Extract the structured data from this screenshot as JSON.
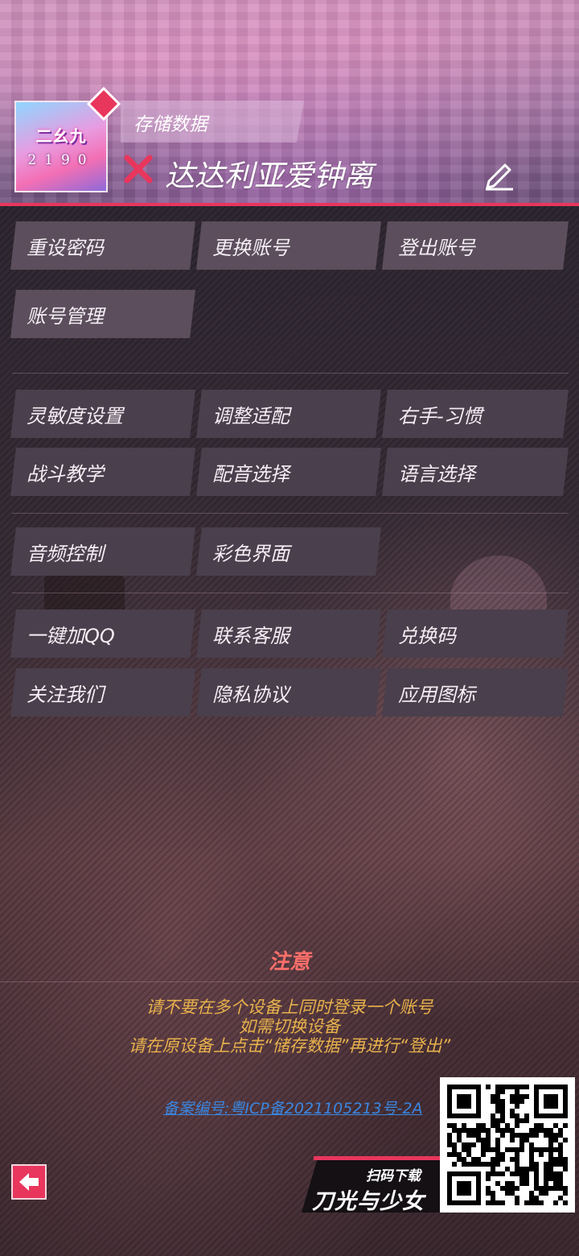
{
  "header": {
    "avatar_title": "二幺九",
    "avatar_number": "2190",
    "save_tab_label": "存储数据",
    "player_name": "达达利亚爱钟离"
  },
  "account": {
    "reset_password": "重设密码",
    "switch_account": "更换账号",
    "logout": "登出账号",
    "manage": "账号管理"
  },
  "settings": {
    "sensitivity": "灵敏度设置",
    "adapt": "调整适配",
    "right_hand": "右手-习惯",
    "tutorial": "战斗教学",
    "voice": "配音选择",
    "language": "语言选择",
    "audio": "音频控制",
    "color_ui": "彩色界面"
  },
  "social": {
    "add_qq": "一键加QQ",
    "support": "联系客服",
    "redeem": "兑换码",
    "follow": "关注我们",
    "privacy": "隐私协议",
    "app_icon": "应用图标"
  },
  "notice": {
    "title": "注意",
    "line1": "请不要在多个设备上同时登录一个账号",
    "line2": "如需切换设备",
    "line3": "请在原设备上点击“储存数据”再进行“登出”"
  },
  "icp": "备案编号:粤ICP备2021105213号-2A",
  "banner": {
    "scan_label": "扫码下载",
    "game_name": "刀光与少女"
  },
  "colors": {
    "accent": "#e8365d",
    "notice_title": "#ff6f6a",
    "notice_text": "#e8b24c",
    "link": "#3a86e0",
    "button": "#4a3f4c"
  },
  "icons": {
    "close": "close-x-icon",
    "edit": "pencil-icon",
    "back": "left-arrow-icon",
    "qr": "qr-code"
  }
}
